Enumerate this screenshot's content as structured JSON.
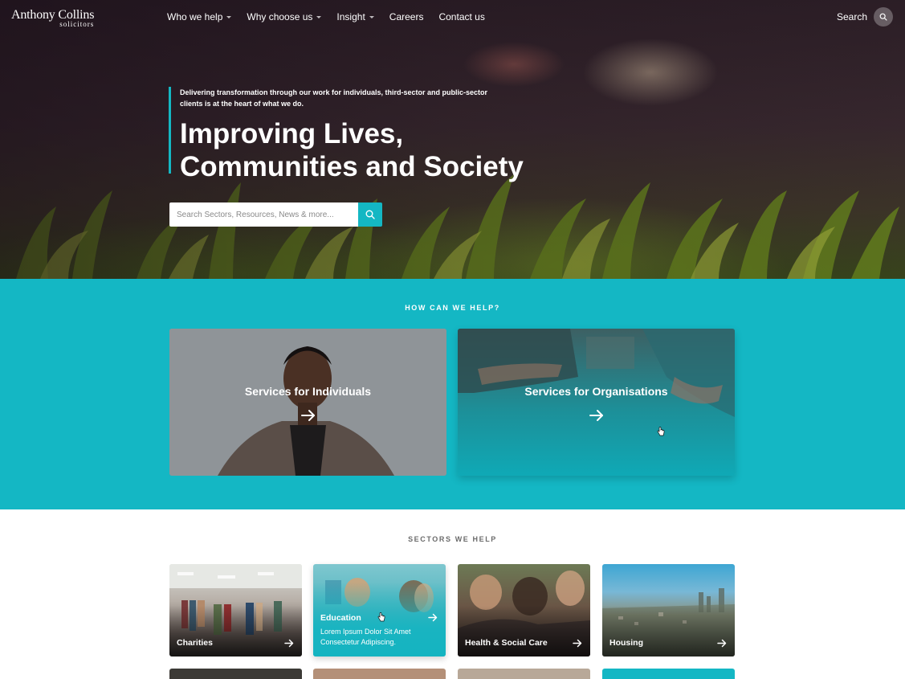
{
  "nav": {
    "logo_brand": "Anthony Collins",
    "logo_sub": "solicitors",
    "links": [
      {
        "label": "Who we help"
      },
      {
        "label": "Why choose us"
      },
      {
        "label": "Insight"
      },
      {
        "label": "Careers"
      },
      {
        "label": "Contact us"
      }
    ],
    "search_label": "Search"
  },
  "hero": {
    "intro": "Delivering transformation through our work for individuals, third-sector and public-sector clients is at the heart of what we do.",
    "title": "Improving Lives, Communities and Society",
    "search_placeholder": "Search Sectors, Resources, News & more..."
  },
  "help": {
    "heading": "HOW CAN WE HELP?",
    "cards": [
      {
        "label": "Services for Individuals"
      },
      {
        "label": "Services for Organisations"
      }
    ]
  },
  "sectors": {
    "heading": "SECTORS WE HELP",
    "tiles": [
      {
        "label": "Charities"
      },
      {
        "label": "Education",
        "description": "Lorem Ipsum Dolor Sit Amet Consectetur Adipiscing."
      },
      {
        "label": "Health & Social Care"
      },
      {
        "label": "Housing"
      }
    ]
  },
  "colors": {
    "accent": "#14b7c4",
    "white": "#ffffff"
  }
}
